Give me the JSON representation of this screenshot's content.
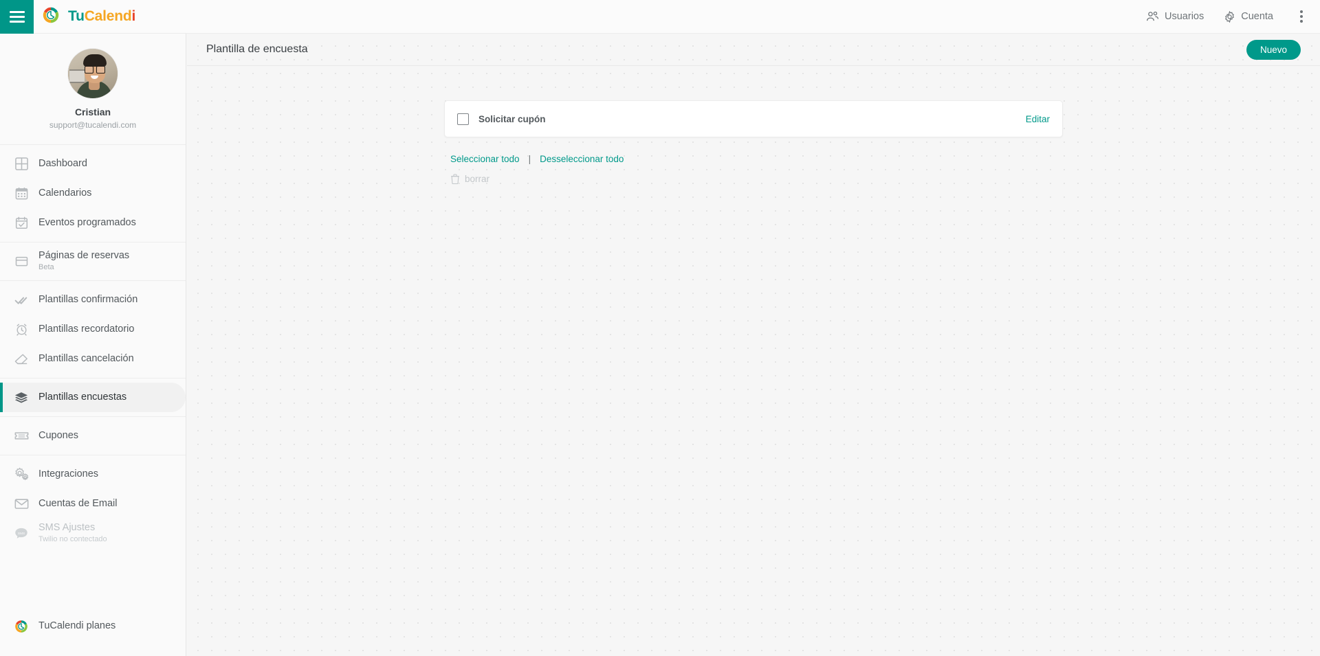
{
  "header": {
    "menu_button": "menu-icon",
    "brand": {
      "part1": "Tu",
      "part2": "Calend",
      "part3": "i"
    },
    "items": [
      {
        "label": "Usuarios",
        "icon": "users-icon"
      },
      {
        "label": "Cuenta",
        "icon": "gear-icon"
      }
    ],
    "overflow_icon": "kebab-menu-icon"
  },
  "sidebar": {
    "profile": {
      "name": "Cristian",
      "email": "support@tucalendi.com",
      "avatar": "user-avatar"
    },
    "groups": [
      {
        "items": [
          {
            "label": "Dashboard",
            "icon": "grid-icon",
            "sub": "",
            "state": "default"
          },
          {
            "label": "Calendarios",
            "icon": "calendar-icon",
            "sub": "",
            "state": "default"
          },
          {
            "label": "Eventos programados",
            "icon": "calendar-check-icon",
            "sub": "",
            "state": "default"
          }
        ]
      },
      {
        "items": [
          {
            "label": "Páginas de reservas",
            "icon": "window-icon",
            "sub": "Beta",
            "state": "default"
          }
        ]
      },
      {
        "items": [
          {
            "label": "Plantillas confirmación",
            "icon": "double-check-icon",
            "sub": "",
            "state": "default"
          },
          {
            "label": "Plantillas recordatorio",
            "icon": "alarm-clock-icon",
            "sub": "",
            "state": "default"
          },
          {
            "label": "Plantillas cancelación",
            "icon": "eraser-icon",
            "sub": "",
            "state": "default"
          }
        ]
      },
      {
        "items": [
          {
            "label": "Plantillas encuestas",
            "icon": "layers-icon",
            "sub": "",
            "state": "active"
          }
        ]
      },
      {
        "items": [
          {
            "label": "Cupones",
            "icon": "ticket-icon",
            "sub": "",
            "state": "default"
          }
        ]
      },
      {
        "items": [
          {
            "label": "Integraciones",
            "icon": "gears-icon",
            "sub": "",
            "state": "default"
          },
          {
            "label": "Cuentas de Email",
            "icon": "envelope-icon",
            "sub": "",
            "state": "default"
          },
          {
            "label": "SMS Ajustes",
            "icon": "sms-bubble-icon",
            "sub": "Twilio no contectado",
            "state": "disabled"
          }
        ]
      }
    ],
    "bottom": {
      "label": "TuCalendi planes",
      "icon": "tucalendi-logo-icon"
    }
  },
  "main": {
    "page_title": "Plantilla de encuesta",
    "new_button": "Nuevo",
    "cards": [
      {
        "label": "Solicitar cupón",
        "edit_label": "Editar",
        "checked": false
      }
    ],
    "select_all": "Seleccionar todo",
    "separator": "|",
    "deselect_all": "Desseleccionar todo",
    "delete_label": "borrar",
    "delete_icon": "trash-icon"
  },
  "colors": {
    "accent": "#009688",
    "accent_link": "#00998a",
    "page_bg": "#f6f6f6",
    "sidebar_bg": "#fafafa",
    "disabled_text": "#c3c7ca"
  }
}
